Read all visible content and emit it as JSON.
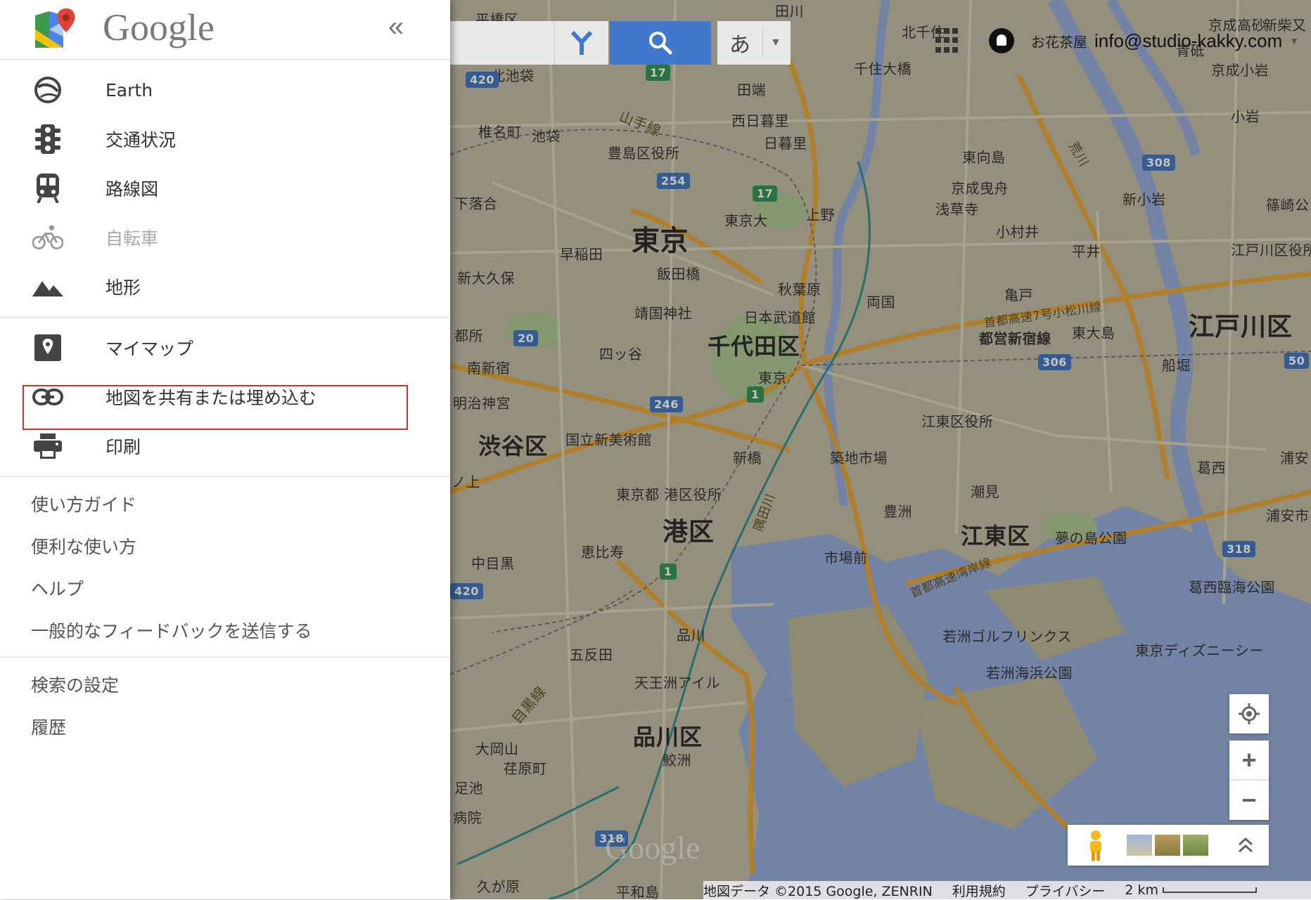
{
  "sidebar": {
    "brand": "Google",
    "collapse_icon": "«",
    "layers": [
      {
        "label": "Earth",
        "icon": "earth-icon"
      },
      {
        "label": "交通状況",
        "icon": "traffic-icon"
      },
      {
        "label": "路線図",
        "icon": "transit-icon"
      },
      {
        "label": "自転車",
        "icon": "bicycle-icon",
        "disabled": true
      },
      {
        "label": "地形",
        "icon": "terrain-icon"
      }
    ],
    "tools": [
      {
        "label": "マイマップ",
        "icon": "mymaps-icon"
      },
      {
        "label": "地図を共有または埋め込む",
        "icon": "link-icon",
        "highlighted": true
      },
      {
        "label": "印刷",
        "icon": "print-icon"
      }
    ],
    "help_links": [
      "使い方ガイド",
      "便利な使い方",
      "ヘルプ",
      "一般的なフィードバックを送信する"
    ],
    "settings_links": [
      "検索の設定",
      "履歴"
    ]
  },
  "search": {
    "directions_icon": "directions-icon",
    "search_icon": "search-icon",
    "ime_char": "あ"
  },
  "account": {
    "email": "info@studio-kakky.com",
    "notification_label": "お花茶屋"
  },
  "map_labels": {
    "wards": [
      "東京",
      "千代田区",
      "港区",
      "渋谷区",
      "品川区",
      "江東区",
      "江戸川区"
    ],
    "places": [
      "北千住",
      "京成高砂",
      "新柴又",
      "千住大橋",
      "田端",
      "西日暮里",
      "日暮里",
      "山手線",
      "椎名町",
      "池袋",
      "豊島区役所",
      "東向島",
      "京成曳舟",
      "浅草寺",
      "小村井",
      "新小岩",
      "篠崎公",
      "下落合",
      "東京大",
      "上野",
      "早稲田",
      "飯田橋",
      "平井",
      "江戸川区役所",
      "新大久保",
      "秋葉原",
      "両国",
      "亀戸",
      "首都高速7号小松川線",
      "靖国神社",
      "日本武道館",
      "東大島",
      "都営新宿線",
      "四ッ谷",
      "船堀",
      "南新宿",
      "東京",
      "明治神宮",
      "国立新美術館",
      "江東区役所",
      "新橋",
      "築地市場",
      "葛西",
      "浦安",
      "潮見",
      "東京都 港区役所",
      "豊洲",
      "夢の島公園",
      "浦安市",
      "中目黒",
      "恵比寿",
      "市場前",
      "首都高速湾岸線",
      "葛西臨海公園",
      "若洲ゴルフリンクス",
      "品川",
      "五反田",
      "東京ディズニーシー",
      "若洲海浜公園",
      "天王洲アイル",
      "目黒線",
      "大岡山",
      "鮫洲",
      "荏原町",
      "足池",
      "平和島",
      "久が原",
      "病院",
      "都所",
      "ノ上",
      "田川",
      "平橋区",
      "北池袋",
      "青砥",
      "京成小岩",
      "小岩",
      "隅田川",
      "荒川"
    ],
    "shields": [
      "420",
      "17",
      "254",
      "17",
      "20",
      "308",
      "306",
      "246",
      "1",
      "50",
      "318",
      "1",
      "420",
      "318"
    ]
  },
  "map_controls": {
    "my_location_icon": "my-location-icon",
    "zoom_in": "+",
    "zoom_out": "−",
    "pegman_icon": "pegman-icon",
    "expand_icon": "chevron-up-icon"
  },
  "footer": {
    "attribution": "地図データ ©2015 Google, ZENRIN",
    "terms": "利用規約",
    "privacy": "プライバシー",
    "scale": "2 km"
  },
  "watermark": "Google",
  "colors": {
    "search_blue": "#3f78cd",
    "highlight_red": "#d7302a",
    "expressway_orange": "#e3a12f",
    "water_blue": "#8fa7d6",
    "park_green": "#a8c38a"
  }
}
